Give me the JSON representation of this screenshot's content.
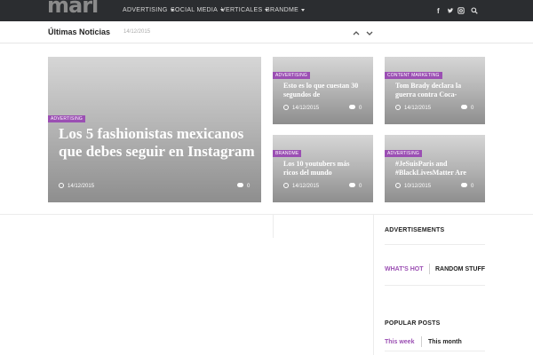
{
  "header": {
    "logo_text": "marl",
    "nav": [
      {
        "label": "ADVERTISING"
      },
      {
        "label": "SOCIAL MEDIA"
      },
      {
        "label": "VERTICALES"
      },
      {
        "label": "BRANDME"
      }
    ],
    "social_icons": [
      "facebook-icon",
      "twitter-icon",
      "instagram-icon",
      "search-icon"
    ]
  },
  "ticker": {
    "title": "Últimas Noticias",
    "date": "14/12/2015"
  },
  "featured": {
    "badge": "ADVERTISING",
    "title": "Los 5 fashionistas mexicanos que debes seguir en Instagram",
    "date": "14/12/2015",
    "comments": "0"
  },
  "cards": [
    {
      "badge": "ADVERTISING",
      "title": "Esto es lo que cuestan 30 segundos de",
      "date": "14/12/2015",
      "comments": "0"
    },
    {
      "badge": "CONTENT MARKETING",
      "title": "Tom Brady declara la guerra contra Coca-",
      "date": "14/12/2015",
      "comments": "0"
    },
    {
      "badge": "BRANDME",
      "title": "Los 10 youtubers más ricos del mundo",
      "date": "14/12/2015",
      "comments": "0"
    },
    {
      "badge": "ADVERTISING",
      "title": "#JeSuisParis and #BlackLivesMatter Are",
      "date": "10/12/2015",
      "comments": "0"
    }
  ],
  "sidebar": {
    "advertisements": "ADVERTISEMENTS",
    "tabs": [
      {
        "label": "WHAT'S HOT"
      },
      {
        "label": "RANDOM STUFF"
      }
    ],
    "popular_heading": "POPULAR POSTS",
    "popular_tabs": [
      {
        "label": "This week"
      },
      {
        "label": "This month"
      }
    ]
  },
  "colors": {
    "accent": "#9b4fb3",
    "topbar": "#2b2d30"
  }
}
